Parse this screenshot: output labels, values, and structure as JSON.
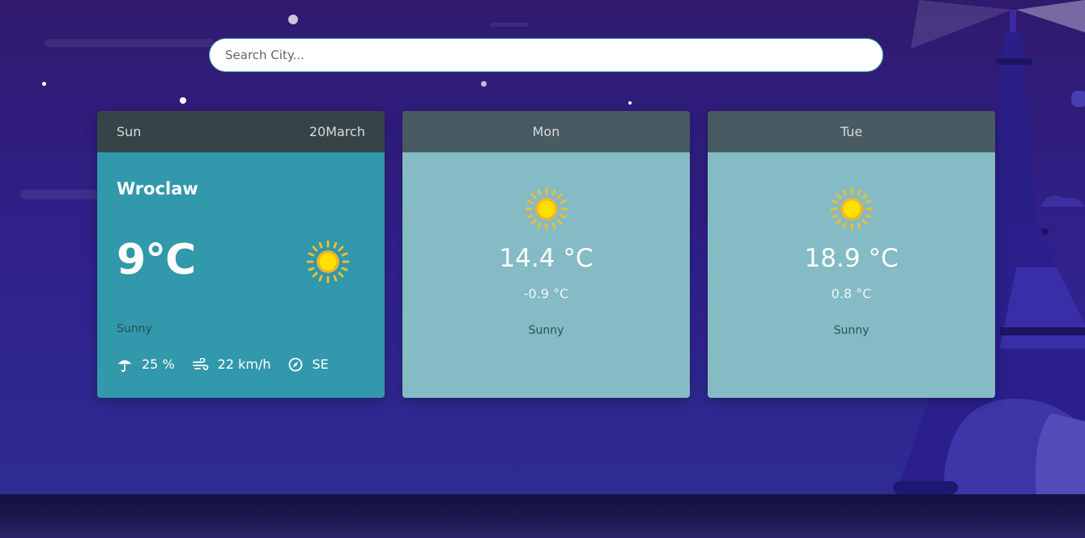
{
  "search": {
    "placeholder": "Search City..."
  },
  "today": {
    "day": "Sun",
    "date": "20March",
    "city": "Wroclaw",
    "temp": "9°C",
    "condition": "Sunny",
    "icon": "sun-icon",
    "stats": {
      "precipitation": "25 %",
      "wind": "22 km/h",
      "direction": "SE"
    }
  },
  "forecast": [
    {
      "day": "Mon",
      "max": "14.4 °C",
      "min": "-0.9 °C",
      "condition": "Sunny",
      "icon": "sun-icon"
    },
    {
      "day": "Tue",
      "max": "18.9 °C",
      "min": "0.8 °C",
      "condition": "Sunny",
      "icon": "sun-icon"
    }
  ],
  "colors": {
    "background": "#30208a",
    "today_card": "#3298ab",
    "forecast_card": "#84bbc4",
    "card_header": "#374447",
    "sun": "#f4d300"
  }
}
